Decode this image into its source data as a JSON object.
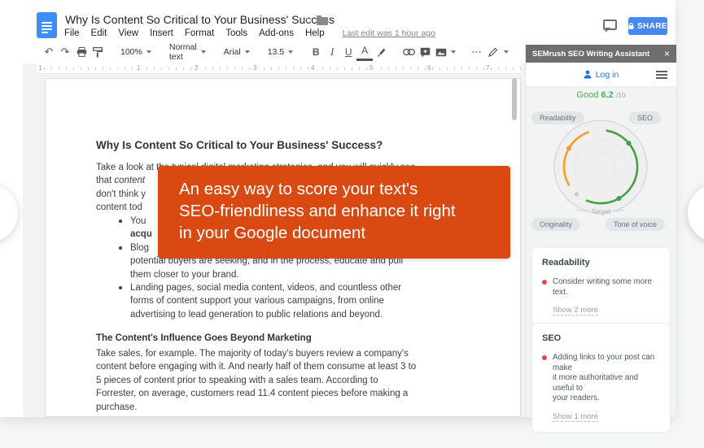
{
  "colors": {
    "accent_orange": "#d84a12",
    "share_blue": "#4688f1",
    "good_green": "#4caf50",
    "gauge_green": "#43a047",
    "gauge_orange": "#f59d25",
    "issue_red": "#e8453c",
    "docs_blue": "#3e8ef7"
  },
  "icons": {
    "undo": "↶",
    "redo": "↷",
    "more": "⋯",
    "star": "☆",
    "close": "×"
  },
  "docs": {
    "title": "Why Is Content So Critical to Your Business' Success",
    "menu": [
      "File",
      "Edit",
      "View",
      "Insert",
      "Format",
      "Tools",
      "Add-ons",
      "Help"
    ],
    "last_edit": "Last edit was 1 hour ago",
    "share_label": "SHARE",
    "toolbar": {
      "zoom": "100%",
      "style": "Normal text",
      "font": "Arial",
      "size": "13.5",
      "bold": "B",
      "italic": "I",
      "underline": "U",
      "text_color": "A"
    }
  },
  "ruler": {
    "numbers": [
      "1",
      "1",
      "2",
      "3",
      "4",
      "5",
      "6",
      "7"
    ]
  },
  "document": {
    "heading": "Why Is Content So Critical to Your Business' Success?",
    "p1_line1": "Take a look at the typical digital marketing strategies, and you will quickly see",
    "p1_line2_pre": "that ",
    "p1_line2_italic": "content",
    "p1_line3": "don't think y",
    "p1_line4": "content tod",
    "bullet1_line1": "You",
    "bullet1_line2_bold": "acqu",
    "bullet2": "Blog\npotential buyers are seeking, and in the process, educate and pull\nthem closer to your brand.",
    "bullet3": "Landing pages, social media content, videos, and countless other\nforms of content support your various campaigns, from online\nadvertising to lead generation to public relations and beyond.",
    "subheading": "The Content's Influence Goes Beyond Marketing",
    "p2": "Take sales, for example. The majority of today's buyers review a company's\ncontent before engaging with it. And nearly half of them consume at least 3 to\n5 pieces of content prior to speaking with a sales team. According to\nForrester, on average, customers read 11.4 content pieces before making a\npurchase."
  },
  "tooltip": {
    "text": "An easy way to score your text's\nSEO-friendliness and enhance it right\nin your Google document"
  },
  "sidebar": {
    "title": "SEMrush SEO Writing Assistant",
    "login_label": "Log in",
    "score": {
      "label": "Good",
      "value": "6.2",
      "outof": "/10"
    },
    "gauge": {
      "labels": {
        "top_left": "Readability",
        "top_right": "SEO",
        "bottom_left": "Originality",
        "bottom_right": "Tone of voice"
      },
      "target_label": "Target"
    },
    "readability_card": {
      "title": "Readability",
      "issue": "Consider writing some more text.",
      "more_link": "Show 2 more"
    },
    "seo_card": {
      "title": "SEO",
      "issue": "Adding links to your post can make\nit more authoritative and useful to\nyour readers.",
      "more_link": "Show 1 more"
    }
  }
}
